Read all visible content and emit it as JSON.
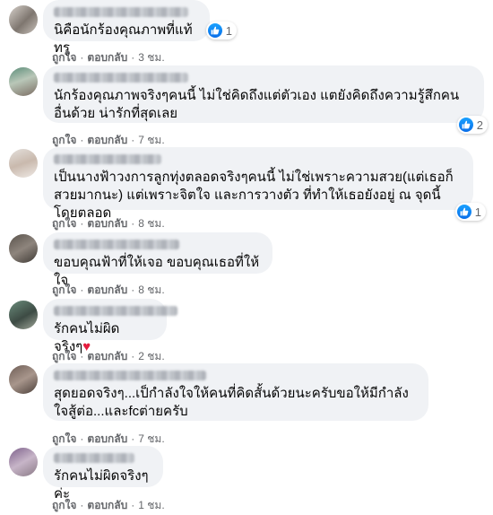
{
  "comments": [
    {
      "text": "นิคือนักร้องคุณภาพที่แท้ทรู",
      "reactions": "1",
      "like": "ถูกใจ",
      "reply": "ตอบกลับ",
      "time": "3 ชม."
    },
    {
      "text": "นักร้องคุณภาพจริงๆคนนี้ ไม่ใช่คิดถึงแต่ตัวเอง แตยังคิดถึงความรู้สึกคนอื่นด้วย น่ารักที่สุดเลย",
      "reactions": "2",
      "like": "ถูกใจ",
      "reply": "ตอบกลับ",
      "time": "7 ชม."
    },
    {
      "text": "เป็นนางฟ้าวงการลูกทุ่งตลอดจริงๆคนนี้ ไม่ใช่เพราะความสวย(แต่เธอก็สวยมากนะ) แต่เพราะจิตใจ และการวางตัว ที่ทำให้เธอยังอยู่ ณ จุดนี้โดยตลอด",
      "reactions": "1",
      "like": "ถูกใจ",
      "reply": "ตอบกลับ",
      "time": "8 ชม."
    },
    {
      "text": "ขอบคุณฟ้าที่ให้เจอ ขอบคุณเธอที่ให้ใจ",
      "like": "ถูกใจ",
      "reply": "ตอบกลับ",
      "time": "8 ชม."
    },
    {
      "text": "รักคนไม่ผิดจริงๆ",
      "emoji": "♥",
      "like": "ถูกใจ",
      "reply": "ตอบกลับ",
      "time": "2 ชม."
    },
    {
      "text": "สุดยอดจริงๆ...เป็กำลังใจให้คนที่คิดสั้นด้วยนะครับขอให้มีกำลังใจสู้ต่อ...และfcต่ายครับ",
      "like": "ถูกใจ",
      "reply": "ตอบกลับ",
      "time": "7 ชม."
    },
    {
      "text": "รักคนไม่ผิดจริงๆค่ะ",
      "like": "ถูกใจ",
      "reply": "ตอบกลับ",
      "time": "1 ชม."
    }
  ],
  "colors": {
    "bubble": "#f0f2f5",
    "meta": "#65676b",
    "like": "#1877f2",
    "heart": "#e41e3f"
  }
}
